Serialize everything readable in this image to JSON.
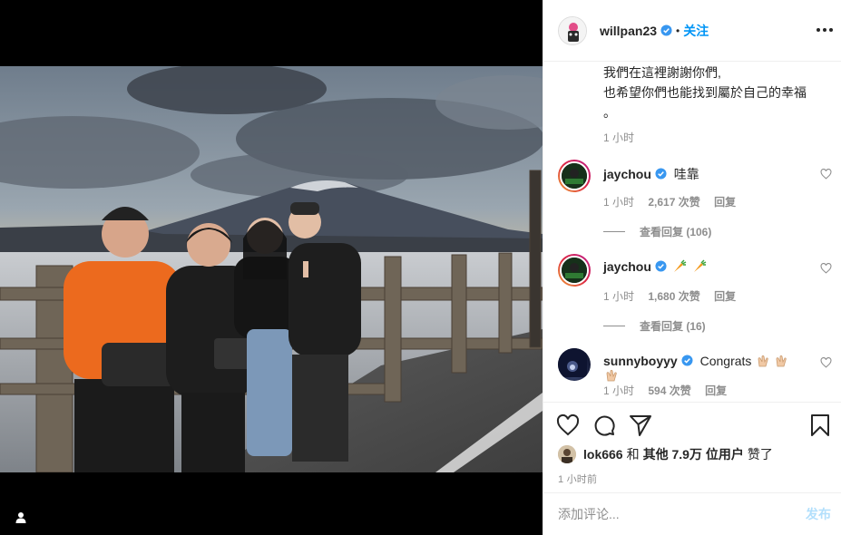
{
  "post": {
    "owner": "willpan23",
    "follow_label": "关注",
    "separator": "•"
  },
  "caption": {
    "lines": [
      "我們在這裡謝謝你們,",
      "也希望你們也能找到屬於自己的幸福",
      "。"
    ],
    "time": "1 小时"
  },
  "comments": [
    {
      "user": "jaychou",
      "text": "哇靠",
      "time": "1 小时",
      "likes": "2,617 次赞",
      "reply_label": "回复",
      "view_replies": "查看回复 (106)",
      "avatar_icon": "jaychou-avatar"
    },
    {
      "user": "jaychou",
      "text": "",
      "emojis": [
        "carrot-emoji",
        "carrot-emoji"
      ],
      "time": "1 小时",
      "likes": "1,680 次赞",
      "reply_label": "回复",
      "view_replies": "查看回复 (16)",
      "avatar_icon": "jaychou-avatar"
    },
    {
      "user": "sunnyboyyy",
      "text": "Congrats",
      "emojis": [
        "clap-emoji",
        "clap-emoji",
        "clap-emoji"
      ],
      "time": "1 小时",
      "likes": "594 次赞",
      "reply_label": "回复",
      "avatar_icon": "sunnyboyyy-avatar"
    }
  ],
  "likes_line": {
    "user": "lok666",
    "and": "和",
    "others": "其他 7.9万 位用户",
    "liked": "赞了"
  },
  "post_time": "1 小时前",
  "add_comment": {
    "placeholder": "添加评论...",
    "post_label": "发布"
  },
  "colors": {
    "accent": "#0095f6",
    "post_disabled": "#b2dffc",
    "muted": "#8e8e8e",
    "text": "#262626"
  }
}
